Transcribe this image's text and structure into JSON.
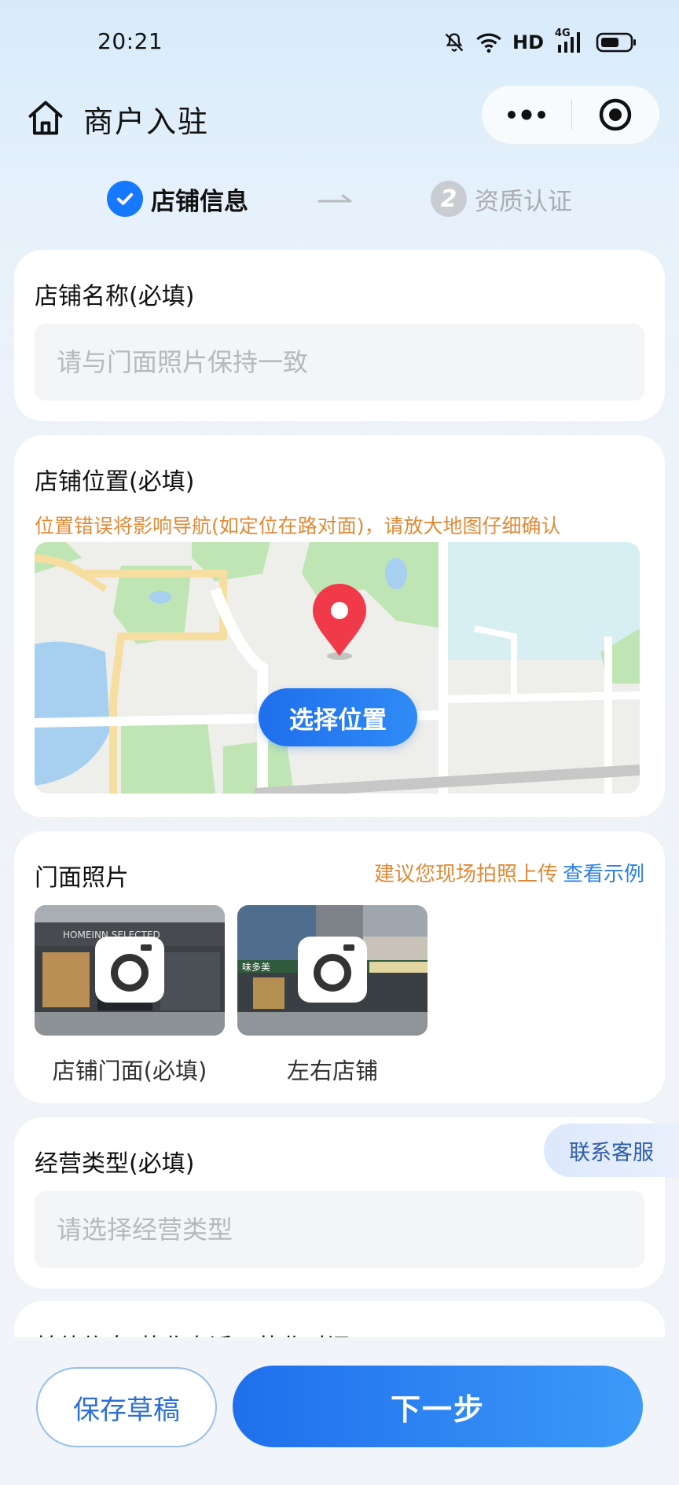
{
  "status_bar": {
    "time": "20:21",
    "hd_label": "HD",
    "network_label": "4G",
    "icons": [
      "bell-off-icon",
      "wifi-icon",
      "signal-icon",
      "battery-icon"
    ]
  },
  "title_bar": {
    "title": "商户入驻",
    "icons": [
      "home-icon",
      "more-icon",
      "close-mini-program-icon"
    ]
  },
  "steps": [
    {
      "label": "店铺信息",
      "state": "done"
    },
    {
      "number": "2",
      "label": "资质认证",
      "state": "pending"
    }
  ],
  "store_name": {
    "label": "店铺名称(必填)",
    "placeholder": "请与门面照片保持一致",
    "value": ""
  },
  "store_location": {
    "label": "店铺位置(必填)",
    "warning": "位置错误将影响导航(如定位在路对面)，请放大地图仔细确认",
    "button": "选择位置"
  },
  "storefront_photos": {
    "label": "门面照片",
    "hint": "建议您现场拍照上传",
    "example_link": "查看示例",
    "tiles": [
      {
        "caption": "店铺门面(必填)",
        "sign_text": "HOMEINN SELECTED"
      },
      {
        "caption": "左右店铺",
        "sign_text": "味多美"
      }
    ]
  },
  "business_type": {
    "label": "经营类型(必填)",
    "placeholder": "请选择经营类型",
    "value": ""
  },
  "other_info": {
    "label": "其他信息(营业电话、营业时间)"
  },
  "contact_service": "联系客服",
  "bottom": {
    "save_draft": "保存草稿",
    "next": "下一步"
  },
  "colors": {
    "accent": "#1677ff",
    "warning": "#e08a37",
    "link": "#2d7fe8",
    "pin": "#f03a4a"
  }
}
